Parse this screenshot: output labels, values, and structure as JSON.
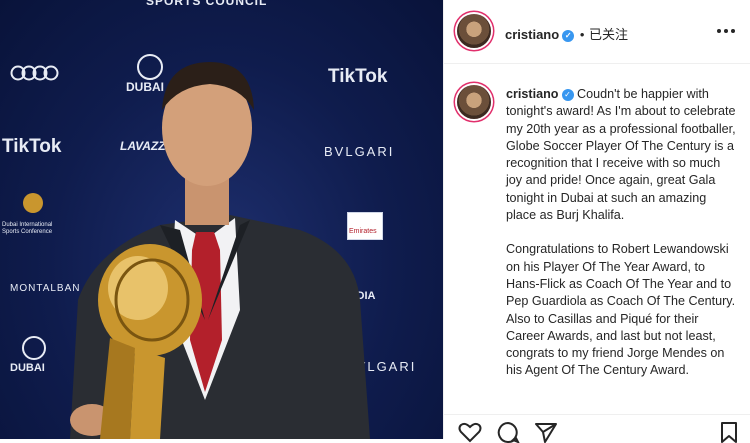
{
  "photo": {
    "backdrop_logos": [
      "SPORTS COUNCIL",
      "Audi",
      "DUBAI",
      "TikTok",
      "TikTok",
      "LAVAZZA",
      "BVLGARI",
      "Emirates",
      "Dubai International Sports Conference",
      "MONTALBAN",
      "DUBAI",
      "BVLGARI",
      "MEDIA"
    ],
    "colors": {
      "backdrop": "#0f1c4d",
      "trophy": "#c9962e",
      "tie": "#b3202b"
    }
  },
  "header": {
    "username": "cristiano",
    "separator": "•",
    "follow_status": "已关注"
  },
  "post": {
    "username": "cristiano",
    "paragraphs": [
      "Coudn't be happier with tonight's award! As I'm about to celebrate my 20th year as a professional footballer, Globe Soccer Player Of The Century is a recognition that I receive with so much joy and pride! Once again, great Gala tonight in Dubai at such an amazing place as Burj Khalifa.",
      "Congratulations to Robert Lewandowski on his Player Of The Year Award, to Hans-Flick as Coach Of The Year and to Pep Guardiola as Coach Of The Century. Also to Casillas and Piqué for their Career Awards, and last but not least, congrats to my friend Jorge Mendes on his Agent Of The Century Award."
    ]
  },
  "actions": {
    "icons": [
      "heart-icon",
      "comment-icon",
      "share-icon",
      "bookmark-icon"
    ]
  },
  "colors": {
    "verified": "#3897f0",
    "text": "#262626",
    "border": "#efefef"
  }
}
